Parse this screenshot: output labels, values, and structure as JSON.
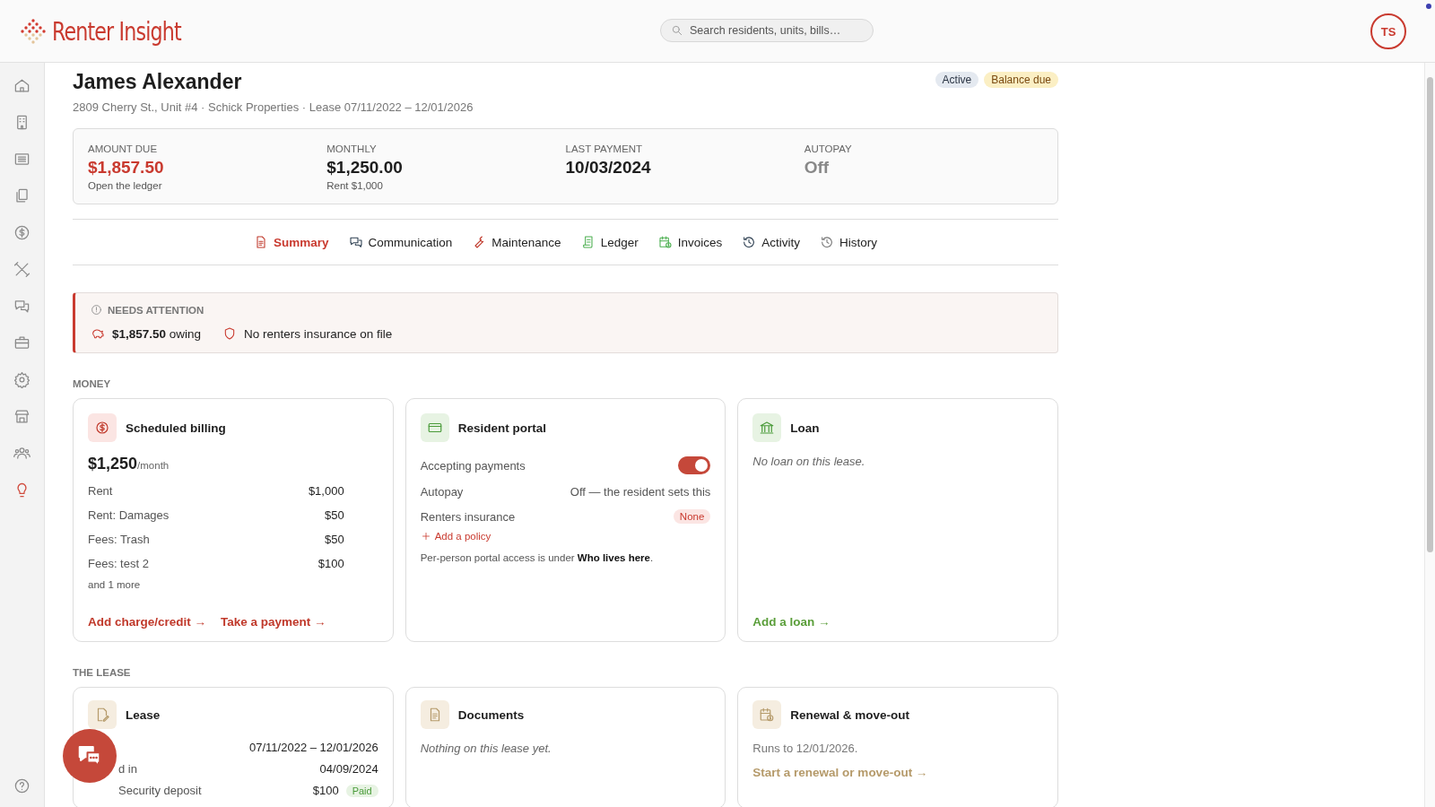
{
  "header": {
    "brand": "Renter Insight",
    "search": {
      "placeholder": "Search residents, units, bills…"
    },
    "avatar": "TS"
  },
  "resident": {
    "name": "James Alexander",
    "subtitle": "2809 Cherry St., Unit #4 · Schick Properties · Lease 07/11/2022 – 12/01/2026",
    "badges": [
      {
        "label": "Active",
        "kind": "status"
      },
      {
        "label": "Balance due",
        "kind": "warning"
      }
    ]
  },
  "summary": [
    {
      "label": "AMOUNT DUE",
      "value": "$1,857.50",
      "note": "Open the ledger",
      "kind": "alert"
    },
    {
      "label": "MONTHLY",
      "value": "$1,250.00",
      "note": "Rent $1,000",
      "kind": "normal"
    },
    {
      "label": "LAST PAYMENT",
      "value": "10/03/2024",
      "kind": "normal"
    },
    {
      "label": "AUTOPAY",
      "value": "Off",
      "kind": "muted"
    }
  ],
  "tabs": [
    {
      "label": "Summary",
      "selected": true
    },
    {
      "label": "Communication",
      "selected": false
    },
    {
      "label": "Maintenance",
      "selected": false
    },
    {
      "label": "Ledger",
      "selected": false
    },
    {
      "label": "Invoices",
      "selected": false
    },
    {
      "label": "Activity",
      "selected": false
    },
    {
      "label": "History",
      "selected": false
    }
  ],
  "attention": {
    "title": "NEEDS ATTENTION",
    "items": [
      {
        "kind": "owing",
        "text": "**$1,857.50** owing"
      },
      {
        "kind": "insurance",
        "text": "No renters insurance on file"
      }
    ]
  },
  "sections": [
    {
      "title": "MONEY",
      "cards": [
        {
          "kind": "billing",
          "title": "Scheduled billing",
          "amount": "$1,250",
          "unit": "/month",
          "rows": [
            {
              "label": "Rent",
              "value": "$1,000"
            },
            {
              "label": "Rent: Damages",
              "value": "$50"
            },
            {
              "label": "Fees: Trash",
              "value": "$50"
            },
            {
              "label": "Fees: test 2",
              "value": "$100"
            }
          ],
          "more": "and 1 more",
          "links": [
            "Add charge/credit →",
            "Take a payment →"
          ]
        },
        {
          "kind": "portal",
          "title": "Resident portal",
          "rows": [
            {
              "kind": "toggle",
              "label": "Accepting payments",
              "on": true
            },
            {
              "kind": "text",
              "label": "Autopay",
              "value": "Off — the resident sets this"
            },
            {
              "kind": "pill",
              "label": "Renters insurance",
              "value": "None"
            }
          ],
          "add": "Add a policy",
          "note": "Per-person portal access is under **Who lives here**."
        },
        {
          "kind": "loan",
          "title": "Loan",
          "empty": "No loan on this lease.",
          "links": [
            "Add a loan →"
          ]
        }
      ]
    },
    {
      "title": "THE LEASE",
      "cards": [
        {
          "kind": "lease",
          "title": "Lease",
          "rows": [
            {
              "value": "07/11/2022 – 12/01/2026"
            },
            {
              "label": "d in",
              "value": "04/09/2024"
            },
            {
              "label": "Security deposit",
              "value": "$100",
              "badge": "Paid"
            }
          ]
        },
        {
          "kind": "documents",
          "title": "Documents",
          "empty": "Nothing on this lease yet."
        },
        {
          "kind": "renewal",
          "title": "Renewal & move-out",
          "text": "Runs to 12/01/2026.",
          "links": [
            "Start a renewal or move-out →"
          ]
        }
      ]
    }
  ]
}
